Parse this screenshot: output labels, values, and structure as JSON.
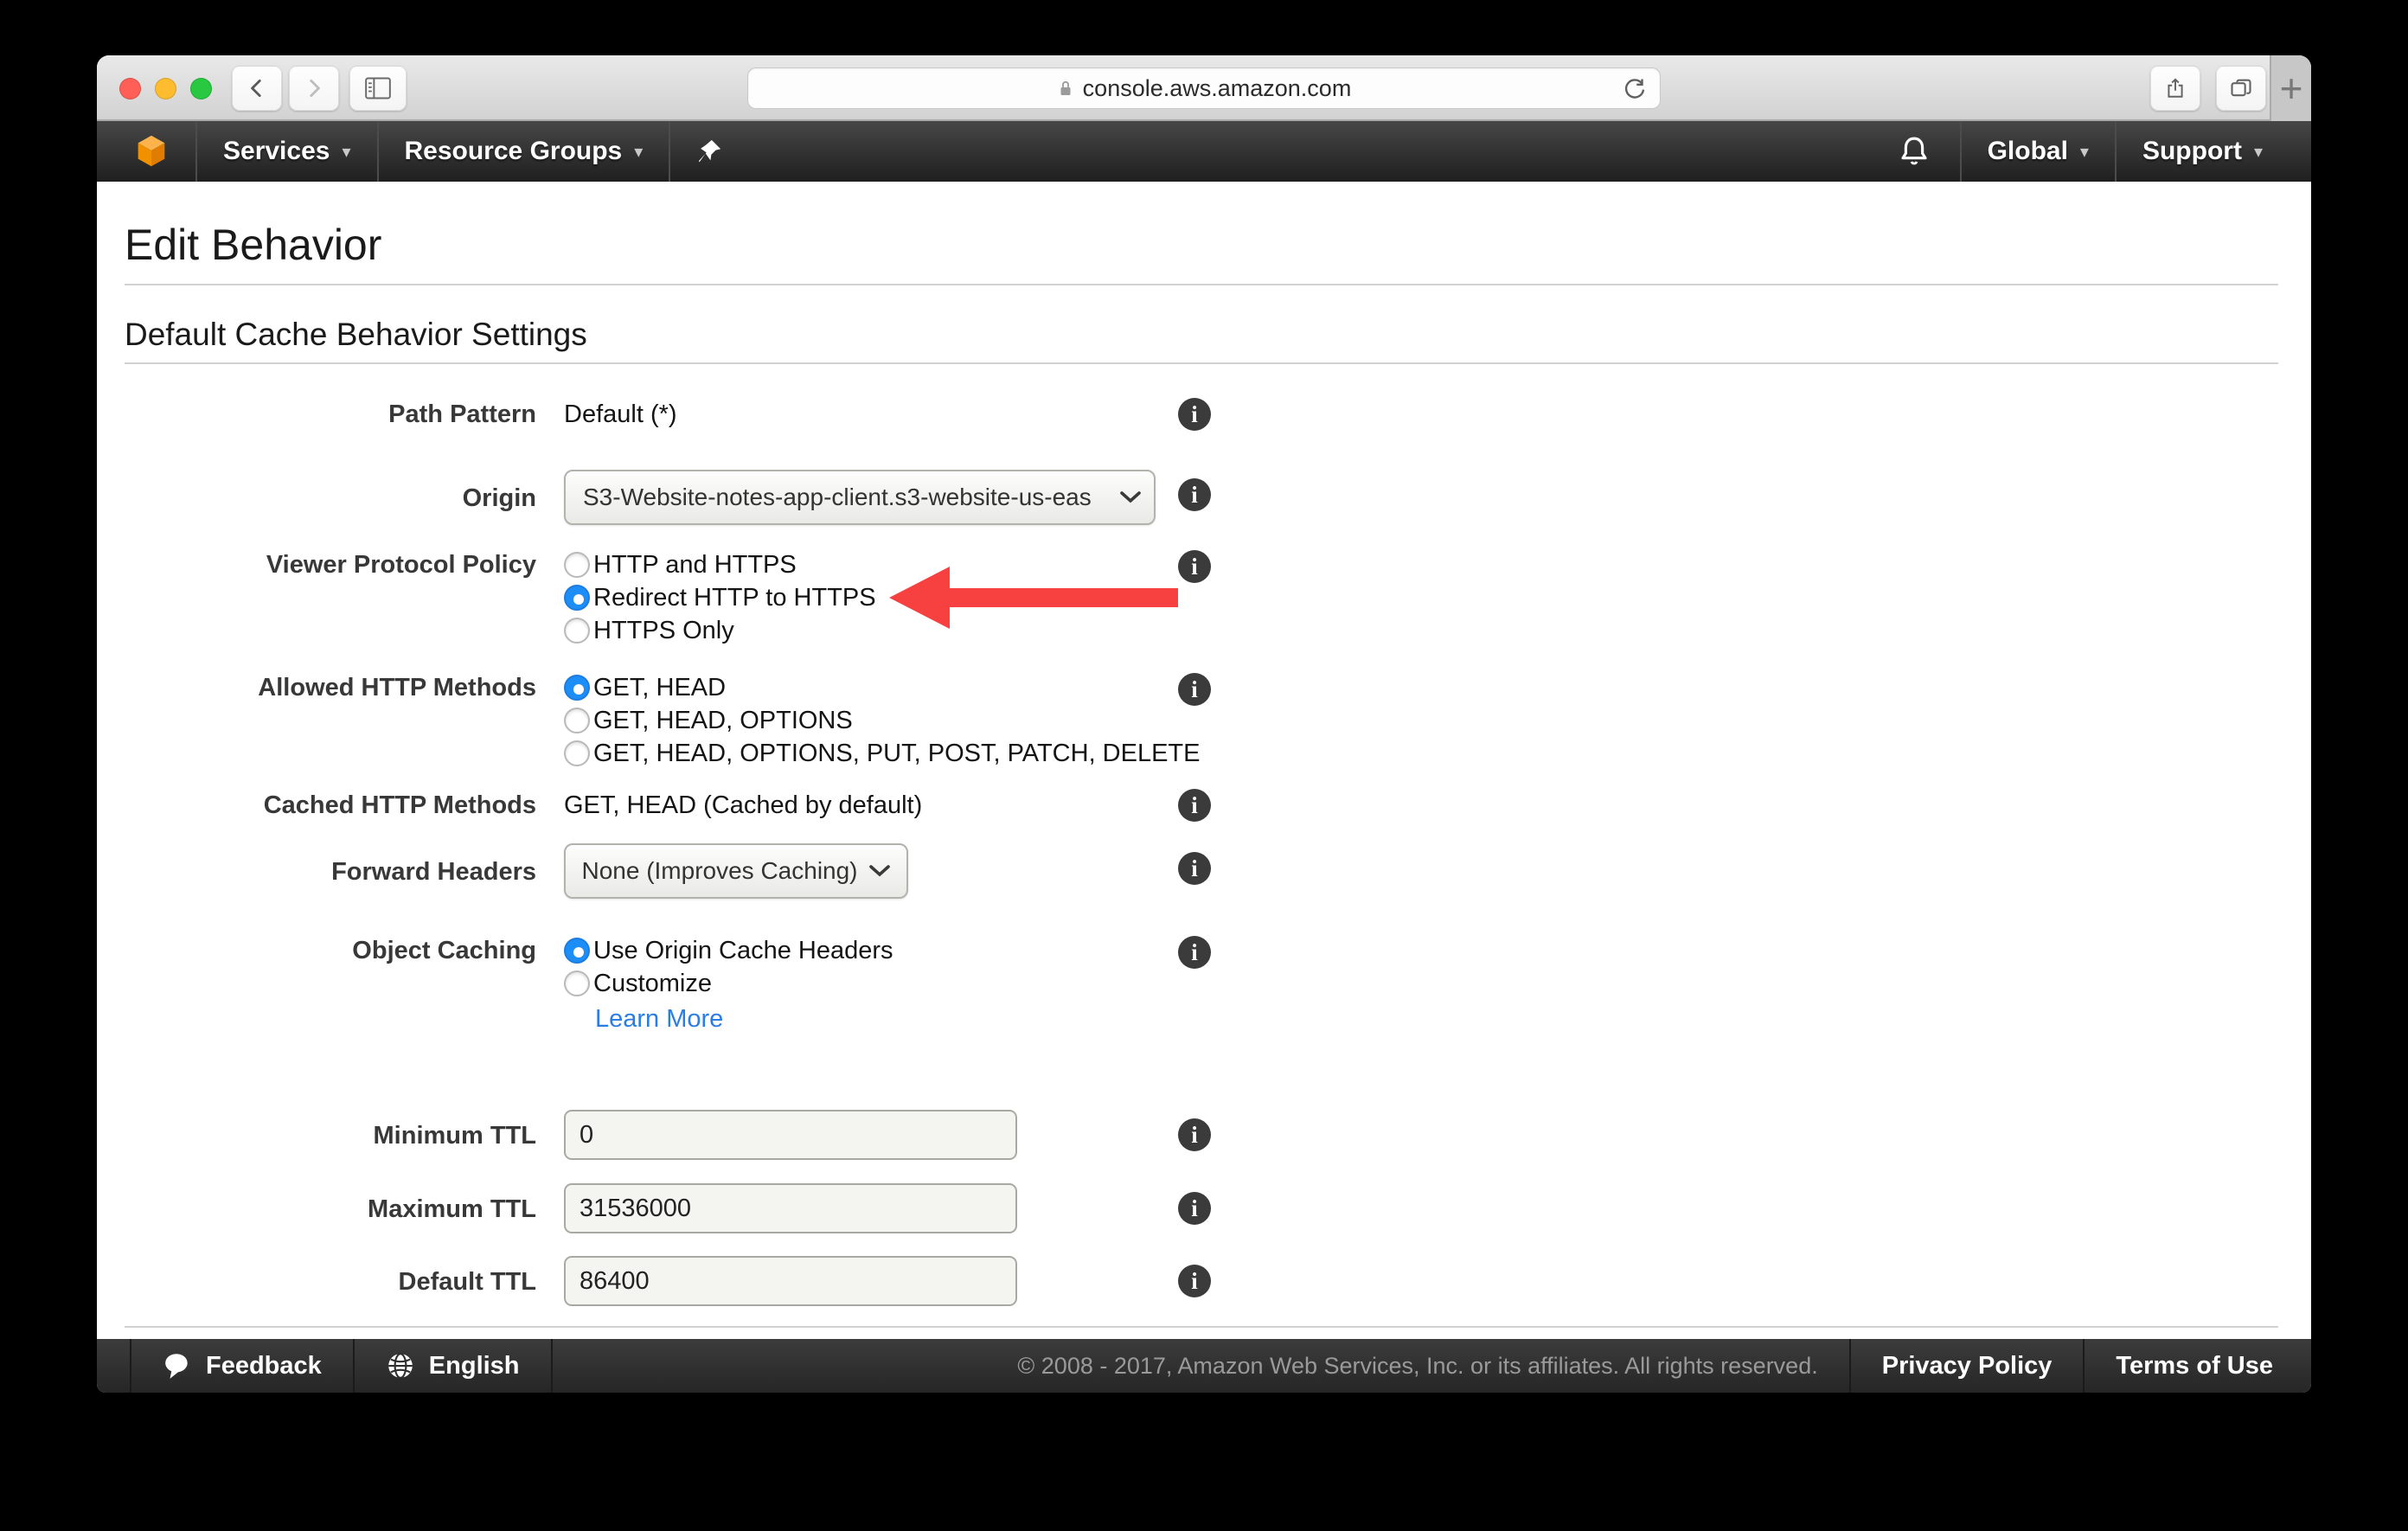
{
  "browser": {
    "url": "console.aws.amazon.com",
    "new_tab_label": "+"
  },
  "nav": {
    "services": "Services",
    "resource_groups": "Resource Groups",
    "global": "Global",
    "support": "Support"
  },
  "page": {
    "title": "Edit Behavior",
    "section": "Default Cache Behavior Settings"
  },
  "form": {
    "path_pattern": {
      "label": "Path Pattern",
      "value": "Default (*)"
    },
    "origin": {
      "label": "Origin",
      "value": "S3-Website-notes-app-client.s3-website-us-eas"
    },
    "viewer_protocol_policy": {
      "label": "Viewer Protocol Policy",
      "options": [
        {
          "label": "HTTP and HTTPS",
          "selected": false
        },
        {
          "label": "Redirect HTTP to HTTPS",
          "selected": true
        },
        {
          "label": "HTTPS Only",
          "selected": false
        }
      ]
    },
    "allowed_http_methods": {
      "label": "Allowed HTTP Methods",
      "options": [
        {
          "label": "GET, HEAD",
          "selected": true
        },
        {
          "label": "GET, HEAD, OPTIONS",
          "selected": false
        },
        {
          "label": "GET, HEAD, OPTIONS, PUT, POST, PATCH, DELETE",
          "selected": false
        }
      ]
    },
    "cached_http_methods": {
      "label": "Cached HTTP Methods",
      "value": "GET, HEAD (Cached by default)"
    },
    "forward_headers": {
      "label": "Forward Headers",
      "value": "None (Improves Caching)"
    },
    "object_caching": {
      "label": "Object Caching",
      "options": [
        {
          "label": "Use Origin Cache Headers",
          "selected": true
        },
        {
          "label": "Customize",
          "selected": false
        }
      ],
      "learn_more": "Learn More"
    },
    "minimum_ttl": {
      "label": "Minimum TTL",
      "value": "0"
    },
    "maximum_ttl": {
      "label": "Maximum TTL",
      "value": "31536000"
    },
    "default_ttl": {
      "label": "Default TTL",
      "value": "86400"
    }
  },
  "footer": {
    "feedback": "Feedback",
    "language": "English",
    "copyright": "© 2008 - 2017, Amazon Web Services, Inc. or its affiliates. All rights reserved.",
    "privacy": "Privacy Policy",
    "terms": "Terms of Use"
  },
  "colors": {
    "accent_red": "#f74040",
    "radio_blue": "#1e8ef7",
    "link_blue": "#2a7de1",
    "aws_orange": "#f79400"
  }
}
